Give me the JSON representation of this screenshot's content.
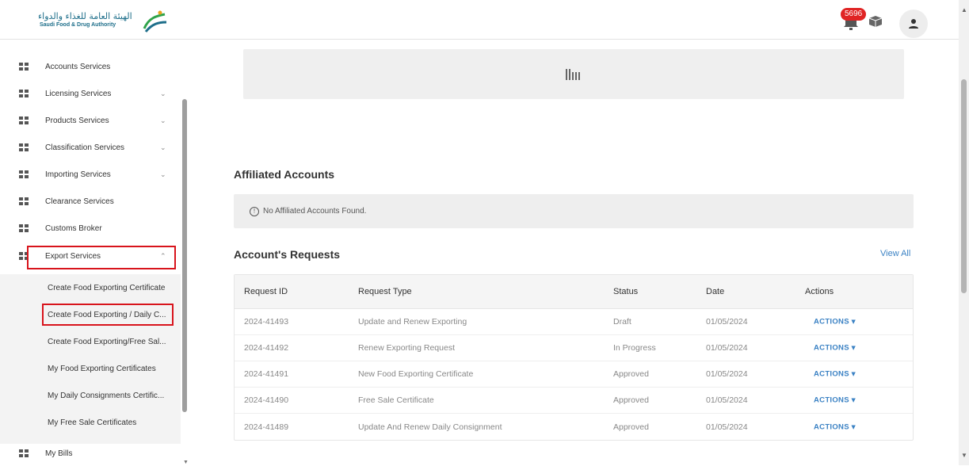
{
  "header": {
    "logo_ar": "الهيئة العامة للغذاء والدواء",
    "logo_en": "Saudi Food & Drug Authority",
    "notification_count": "5696"
  },
  "sidebar": {
    "items": [
      {
        "label": "Accounts Services",
        "chevron": ""
      },
      {
        "label": "Licensing Services",
        "chevron": "⌄"
      },
      {
        "label": "Products Services",
        "chevron": "⌄"
      },
      {
        "label": "Classification Services",
        "chevron": "⌄"
      },
      {
        "label": "Importing Services",
        "chevron": "⌄"
      },
      {
        "label": "Clearance Services",
        "chevron": ""
      },
      {
        "label": "Customs Broker",
        "chevron": ""
      },
      {
        "label": "Export Services",
        "chevron": "⌃"
      }
    ],
    "sub_items": [
      "Create Food Exporting Certificate",
      "Create Food Exporting / Daily C...",
      "Create Food Exporting/Free Sal...",
      "My Food Exporting Certificates",
      "My Daily Consignments Certific...",
      "My Free Sale Certificates"
    ],
    "bills_label": "My Bills"
  },
  "main": {
    "affiliated_title": "Affiliated Accounts",
    "affiliated_empty": "No Affiliated Accounts Found.",
    "requests_title": "Account's Requests",
    "view_all": "View All",
    "table": {
      "headers": [
        "Request ID",
        "Request Type",
        "Status",
        "Date",
        "Actions"
      ],
      "rows": [
        [
          "2024-41493",
          "Update and Renew Exporting",
          "Draft",
          "01/05/2024",
          "ACTIONS ▾"
        ],
        [
          "2024-41492",
          "Renew Exporting Request",
          "In Progress",
          "01/05/2024",
          "ACTIONS ▾"
        ],
        [
          "2024-41491",
          "New Food Exporting Certificate",
          "Approved",
          "01/05/2024",
          "ACTIONS ▾"
        ],
        [
          "2024-41490",
          "Free Sale Certificate",
          "Approved",
          "01/05/2024",
          "ACTIONS ▾"
        ],
        [
          "2024-41489",
          "Update And Renew Daily Consignment",
          "Approved",
          "01/05/2024",
          "ACTIONS ▾"
        ]
      ]
    }
  },
  "colors": {
    "highlight": "#d8141c",
    "link": "#3b82c4",
    "badge": "#e02424"
  },
  "icons": [
    "grid-icon",
    "bell-icon",
    "box-icon",
    "user-icon",
    "chevron-down-icon",
    "chevron-up-icon",
    "info-icon",
    "loading-icon"
  ]
}
